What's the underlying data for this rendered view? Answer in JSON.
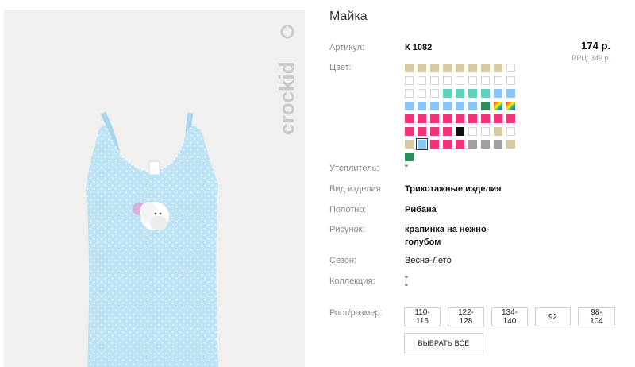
{
  "product": {
    "title": "Майка",
    "brand_logo": "crockid",
    "price": "174 р.",
    "rrc": "РРЦ: 349 р."
  },
  "fields": {
    "article_label": "Артикул:",
    "article_value": "К 1082",
    "color_label": "Цвет:",
    "insulation_label": "Утеплитель:",
    "insulation_value": "\"",
    "kind_label": "Вид изделия",
    "kind_value": "Трикотажные изделия",
    "fabric_label": "Полотно:",
    "fabric_value": "Рибана",
    "pattern_label": "Рисунок:",
    "pattern_value": "крапинка на нежно-голубом",
    "season_label": "Сезон:",
    "season_value": "Весна-Лето",
    "collection_label": "Коллекция:",
    "collection_value_1": "\"",
    "collection_value_2": "\"",
    "size_label": "Рост/размер:"
  },
  "swatches": [
    {
      "color": "#d8c9a5"
    },
    {
      "color": "#d8c9a5"
    },
    {
      "color": "#d8c9a5"
    },
    {
      "color": "#d8c9a5"
    },
    {
      "color": "#d8c9a5"
    },
    {
      "color": "#d8c9a5"
    },
    {
      "color": "#d8c9a5"
    },
    {
      "color": "#d8c9a5"
    },
    {
      "color": "#ffffff"
    },
    {
      "color": "#ffffff"
    },
    {
      "color": "#ffffff"
    },
    {
      "color": "#ffffff"
    },
    {
      "color": "#ffffff"
    },
    {
      "color": "#ffffff"
    },
    {
      "color": "#ffffff"
    },
    {
      "color": "#ffffff"
    },
    {
      "color": "#ffffff"
    },
    {
      "color": "#ffffff"
    },
    {
      "color": "#ffffff"
    },
    {
      "color": "#ffffff"
    },
    {
      "color": "#ffffff"
    },
    {
      "color": "#5fd3c0"
    },
    {
      "color": "#5fd3c0"
    },
    {
      "color": "#5fd3c0"
    },
    {
      "color": "#5fd3c0"
    },
    {
      "color": "#8ec6f2"
    },
    {
      "color": "#8ec6f2"
    },
    {
      "color": "#8ec6f2"
    },
    {
      "color": "#8ec6f2"
    },
    {
      "color": "#8ec6f2"
    },
    {
      "color": "#8ec6f2"
    },
    {
      "color": "#8ec6f2"
    },
    {
      "color": "#8ec6f2"
    },
    {
      "color": "#2e8b57"
    },
    {
      "color": "rainbow"
    },
    {
      "color": "rainbow"
    },
    {
      "color": "#f0357a"
    },
    {
      "color": "#f0357a"
    },
    {
      "color": "#f0357a"
    },
    {
      "color": "#f0357a"
    },
    {
      "color": "#f0357a"
    },
    {
      "color": "#f0357a"
    },
    {
      "color": "#f0357a"
    },
    {
      "color": "#f0357a"
    },
    {
      "color": "#f0357a"
    },
    {
      "color": "#f0357a"
    },
    {
      "color": "#f0357a"
    },
    {
      "color": "#f0357a"
    },
    {
      "color": "#f0357a"
    },
    {
      "color": "#111111"
    },
    {
      "color": "#ffffff"
    },
    {
      "color": "#ffffff"
    },
    {
      "color": "#d8c9a5"
    },
    {
      "color": "#ffffff"
    },
    {
      "color": "#d8c9a5"
    },
    {
      "color": "#8ec6f2",
      "selected": true
    },
    {
      "color": "#f0357a"
    },
    {
      "color": "#f0357a"
    },
    {
      "color": "#f0357a"
    },
    {
      "color": "#a0a0a0"
    },
    {
      "color": "#a0a0a0"
    },
    {
      "color": "#a0a0a0"
    },
    {
      "color": "#d8c9a5"
    },
    {
      "color": "#2e8b57"
    }
  ],
  "sizes": [
    "110-116",
    "122-128",
    "134-140",
    "92",
    "98-104"
  ],
  "select_all_label": "ВЫБРАТЬ ВСЕ"
}
